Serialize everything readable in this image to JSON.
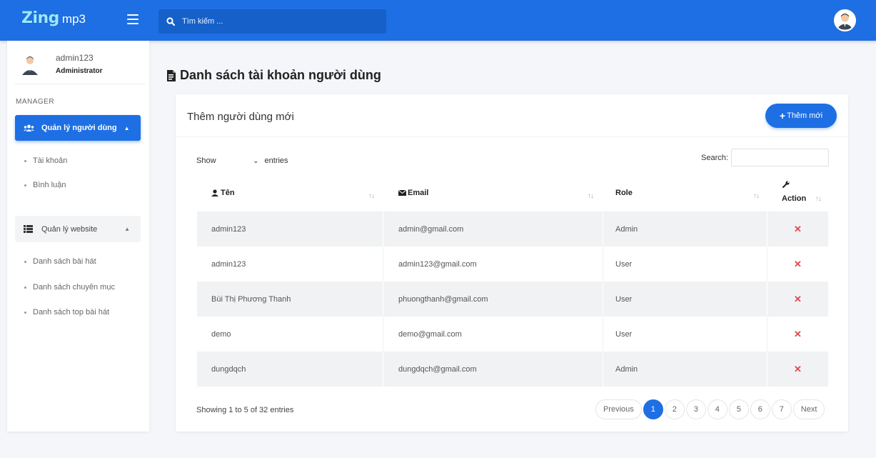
{
  "colors": {
    "primary": "#1e6fe3",
    "danger": "#e0474c",
    "row_alt": "#f1f2f4"
  },
  "brand": {
    "logo": "Zing",
    "suffix": "mp3"
  },
  "search": {
    "placeholder": "Tìm kiếm ..."
  },
  "user": {
    "name": "admin123",
    "role": "Administrator"
  },
  "sidebar": {
    "section_title": "MANAGER",
    "user_menu": {
      "label": "Quản lý người dùng",
      "icon": "users-icon",
      "items": [
        "Tài khoản",
        "Bình luận"
      ]
    },
    "website_menu": {
      "label": "Quản lý website",
      "icon": "list-icon",
      "items": [
        "Danh sách bài hát",
        "Danh sách chuyên mục",
        "Danh sách top bài hát"
      ]
    }
  },
  "page": {
    "title": "Danh sách tài khoản người dùng"
  },
  "card": {
    "title": "Thêm người dùng mới",
    "add_button": "Thêm mới"
  },
  "table_controls": {
    "show": "Show",
    "entries": "entries",
    "search_label": "Search:"
  },
  "table": {
    "headers": {
      "name": "Tên",
      "email": "Email",
      "role": "Role",
      "action": "Action"
    },
    "rows": [
      {
        "name": "admin123",
        "email": "admin@gmail.com",
        "role": "Admin"
      },
      {
        "name": "admin123",
        "email": "admin123@gmail.com",
        "role": "User"
      },
      {
        "name": "Bùi Thị Phương Thanh",
        "email": "phuongthanh@gmail.com",
        "role": "User"
      },
      {
        "name": "demo",
        "email": "demo@gmail.com",
        "role": "User"
      },
      {
        "name": "dungdqch",
        "email": "dungdqch@gmail.com",
        "role": "Admin"
      }
    ]
  },
  "footer": {
    "info": "Showing 1 to 5 of 32 entries",
    "previous": "Previous",
    "next": "Next",
    "pages": [
      "1",
      "2",
      "3",
      "4",
      "5",
      "6",
      "7"
    ],
    "current_page": "1"
  }
}
